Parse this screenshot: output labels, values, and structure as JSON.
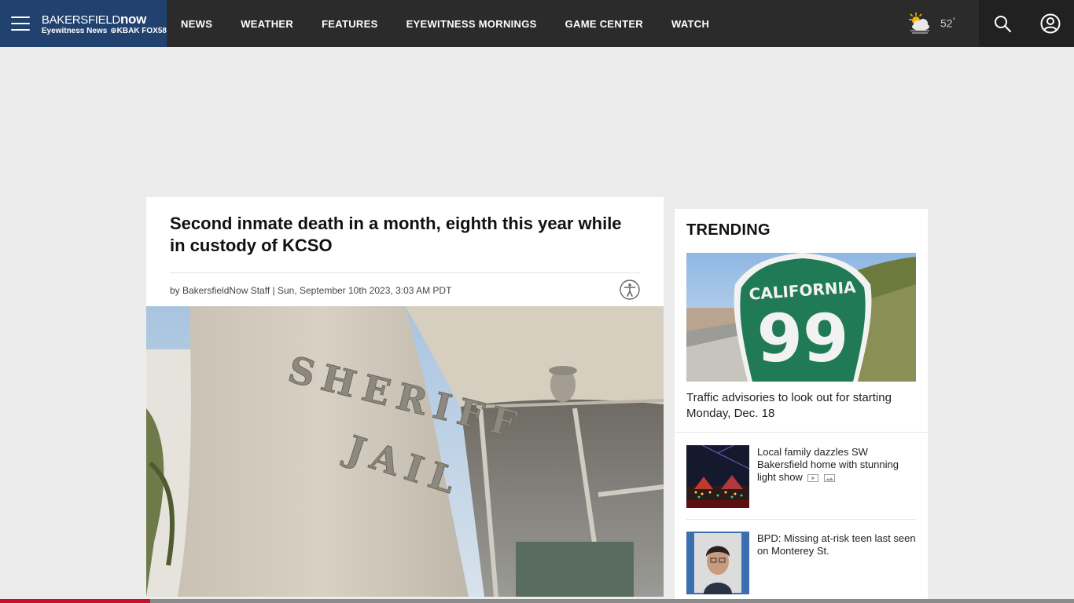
{
  "header": {
    "logo_main_a": "BAKERSFIELD",
    "logo_main_b": "now",
    "logo_sub_a": "Eyewitness News",
    "logo_sub_b": "⊛KBAK FOX58",
    "nav": [
      {
        "label": "NEWS"
      },
      {
        "label": "WEATHER"
      },
      {
        "label": "FEATURES"
      },
      {
        "label": "EYEWITNESS MORNINGS"
      },
      {
        "label": "GAME CENTER"
      },
      {
        "label": "WATCH"
      }
    ],
    "weather": {
      "temp": "52",
      "unit": "°",
      "icon": "partly-sunny-icon"
    },
    "colors": {
      "bar": "#2b2b2b",
      "brand": "#21416e",
      "right": "#212121"
    }
  },
  "article": {
    "headline": "Second inmate death in a month, eighth this year while in custody of KCSO",
    "byline": "by BakersfieldNow Staff | Sun, September 10th 2023, 3:03 AM PDT",
    "image": "sheriff-jail-building-photo",
    "sign_text": [
      "SHERIFF",
      "JAIL"
    ]
  },
  "trending": {
    "title": "TRENDING",
    "hero": {
      "image": "california-99-highway-sign-photo",
      "sign_top": "CALIFORNIA",
      "sign_num": "99",
      "title": "Traffic advisories to look out for starting Monday, Dec. 18"
    },
    "items": [
      {
        "title": "Local family dazzles SW Bakersfield home with stunning light show",
        "image": "holiday-lights-house-photo",
        "has_video": true,
        "has_gallery": true
      },
      {
        "title": "BPD: Missing at-risk teen last seen on Monterey St.",
        "image": "teen-portrait-photo"
      }
    ]
  },
  "progress": {
    "fraction": 0.14,
    "color": "#c8102e"
  }
}
